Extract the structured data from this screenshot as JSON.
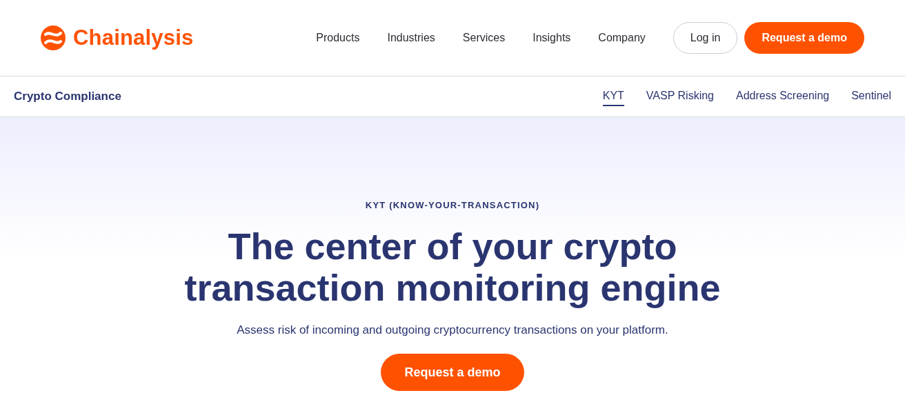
{
  "header": {
    "logo": "Chainalysis",
    "nav": [
      "Products",
      "Industries",
      "Services",
      "Insights",
      "Company"
    ],
    "login": "Log in",
    "cta": "Request a demo"
  },
  "subnav": {
    "title": "Crypto Compliance",
    "tabs": [
      {
        "label": "KYT",
        "selected": true
      },
      {
        "label": "VASP Risking",
        "selected": false
      },
      {
        "label": "Address Screening",
        "selected": false
      },
      {
        "label": "Sentinel",
        "selected": false
      }
    ]
  },
  "hero": {
    "eyebrow": "KYT (KNOW-YOUR-TRANSACTION)",
    "headline": [
      "The center of your crypto",
      "transaction monitoring engine"
    ],
    "subtitle": "Assess risk of incoming and outgoing cryptocurrency transactions on your platform.",
    "cta": "Request a demo"
  }
}
